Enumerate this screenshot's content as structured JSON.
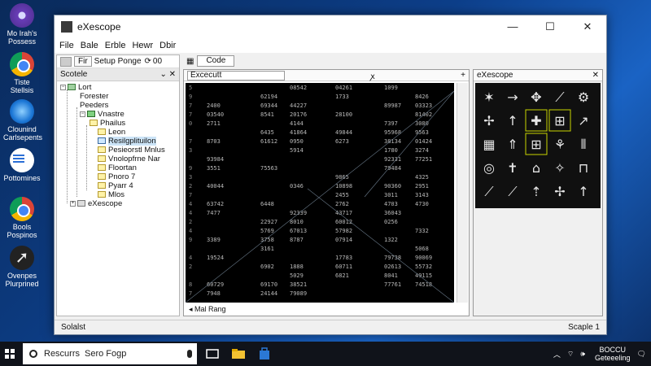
{
  "desktop": {
    "icons": [
      {
        "label": "Mo Irah's Possess",
        "icon": "purple-orb-icon"
      },
      {
        "label": "Tiste Stellsis",
        "icon": "chrome-icon"
      },
      {
        "label": "Clounind Carlsepents",
        "icon": "blue-orb-icon"
      },
      {
        "label": "Pottomines",
        "icon": "document-icon"
      },
      {
        "label": "Bools Pospinos",
        "icon": "chrome-icon"
      },
      {
        "label": "Ovenpes Plurprined",
        "icon": "arrow-cursor-icon"
      }
    ]
  },
  "window": {
    "title": "eXescope",
    "controls": {
      "minimize": "—",
      "maximize": "☐",
      "close": "✕"
    },
    "menu": [
      "File",
      "Bale",
      "Erble",
      "Hewr",
      "Dbir"
    ],
    "left_toolbar": {
      "combo": "Fir",
      "label": "Setup Ponge",
      "value": "00"
    },
    "tree_header": "Scotele",
    "tree": [
      {
        "label": "Lort",
        "indent": 0,
        "type": "expander"
      },
      {
        "label": "Forester",
        "indent": 1,
        "type": "plain"
      },
      {
        "label": "Peeders",
        "indent": 1,
        "type": "plain"
      },
      {
        "label": "Vnastre",
        "indent": 2,
        "type": "green"
      },
      {
        "label": "Phailus",
        "indent": 2,
        "type": "folder"
      },
      {
        "label": "Leon",
        "indent": 3,
        "type": "folder"
      },
      {
        "label": "Resilgplituilon",
        "indent": 3,
        "type": "folder",
        "selected": true
      },
      {
        "label": "Pesieorstl Mnlus",
        "indent": 3,
        "type": "folder"
      },
      {
        "label": "Vnolopfrne Nar",
        "indent": 3,
        "type": "folder"
      },
      {
        "label": "Floortan",
        "indent": 3,
        "type": "folder"
      },
      {
        "label": "Pnoro 7",
        "indent": 3,
        "type": "folder"
      },
      {
        "label": "Pyarr 4",
        "indent": 3,
        "type": "folder"
      },
      {
        "label": "Mlos",
        "indent": 3,
        "type": "folder"
      },
      {
        "label": "eXescope",
        "indent": 1,
        "type": "folder"
      }
    ],
    "code_tab": "Code",
    "code_dropdown": "Excecutt",
    "code_footer": "Mal Rang",
    "icon_header": "eXescope",
    "status_left": "Solalst",
    "status_right": "Scaple 1"
  },
  "taskbar": {
    "search_text": "Rescurrs",
    "search_hint": "Sero Fogp",
    "clock_line1": "BOCCU",
    "clock_line2": "Geteeeling"
  },
  "colors": {
    "accent": "#0d3f8a",
    "hex_bg": "#000000",
    "selection": "#cce4f7",
    "icon_highlight": "#c8d400"
  }
}
